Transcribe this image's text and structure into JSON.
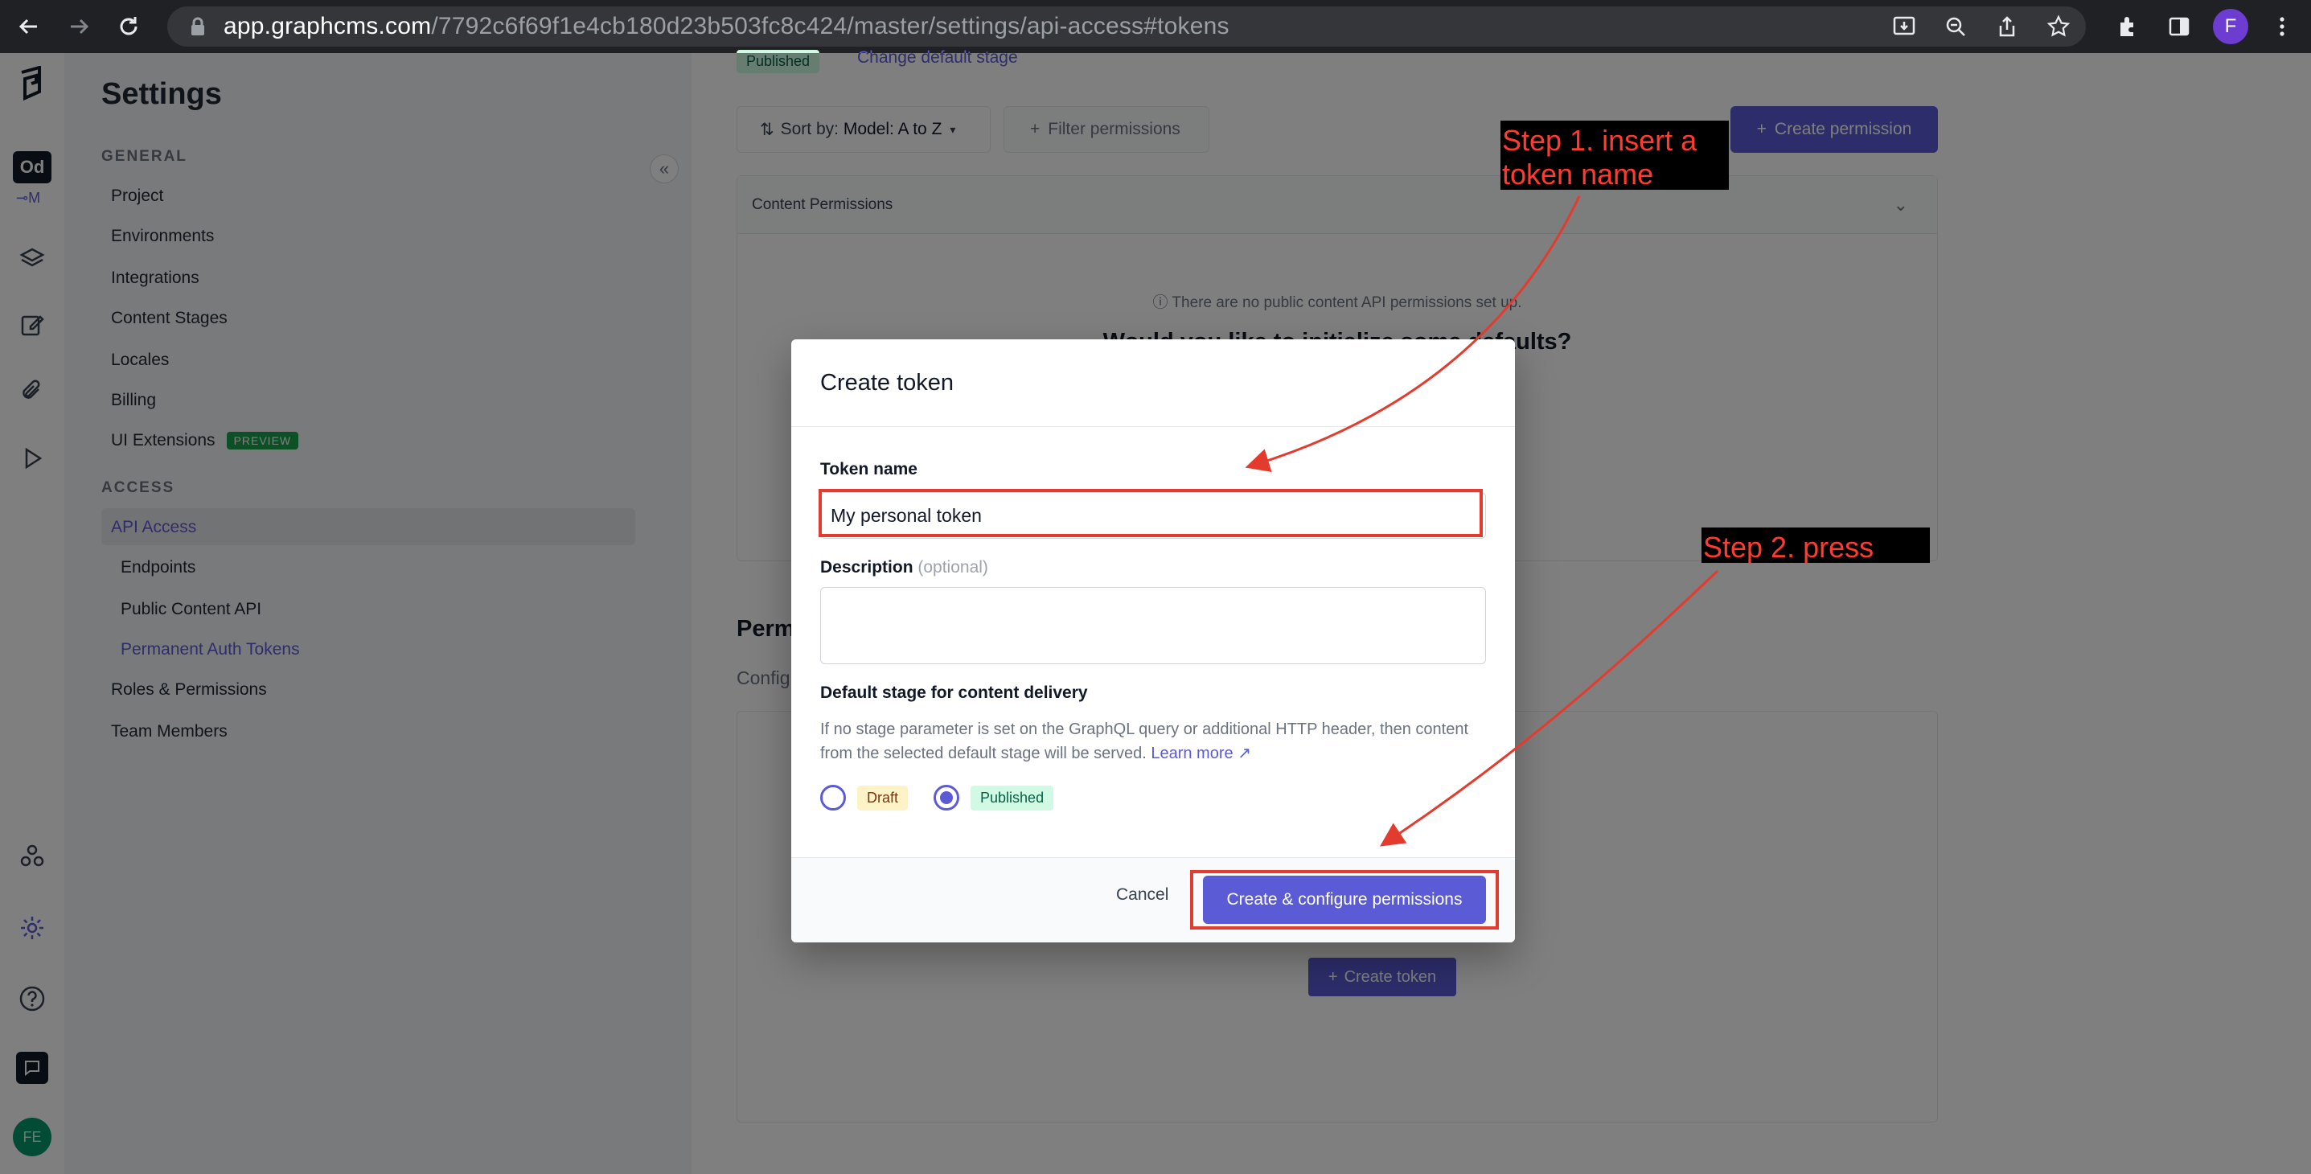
{
  "browser": {
    "url_host": "app.graphcms.com",
    "url_path": "/7792c6f69f1e4cb180d23b503fc8c424/master/settings/api-access#tokens",
    "profile_initial": "F"
  },
  "rail": {
    "project_badge": "Od",
    "project_sub": "⊸M",
    "user_initials": "FE"
  },
  "sidebar": {
    "title": "Settings",
    "general_label": "GENERAL",
    "general_items": [
      "Project",
      "Environments",
      "Integrations",
      "Content Stages",
      "Locales",
      "Billing",
      "UI Extensions"
    ],
    "preview_badge": "PREVIEW",
    "access_label": "ACCESS",
    "api_access": "API Access",
    "api_subitems": [
      "Endpoints",
      "Public Content API",
      "Permanent Auth Tokens"
    ],
    "roles": "Roles & Permissions",
    "team": "Team Members"
  },
  "main": {
    "published_badge": "Published",
    "change_stage": "Change default stage",
    "sort_label": "Sort by:",
    "sort_value": "Model: A to Z",
    "filter_label": "Filter permissions",
    "create_permission": "Create permission",
    "content_permissions": "Content Permissions",
    "no_permissions": "There are no public content API permissions set up.",
    "would_like": "Would you like to initialize some defaults?",
    "perm_heading": "Perm",
    "perm_sub": "Config",
    "create_token_btn": "Create token"
  },
  "modal": {
    "title": "Create token",
    "token_name_label": "Token name",
    "token_name_value": "My personal token",
    "description_label": "Description",
    "optional": "(optional)",
    "stage_label": "Default stage for content delivery",
    "help_text": "If no stage parameter is set on the GraphQL query or additional HTTP header, then content from the selected default stage will be served.",
    "learn_more": "Learn more",
    "stages": [
      "Draft",
      "Published"
    ],
    "selected_stage": "Published",
    "cancel": "Cancel",
    "confirm": "Create & configure permissions"
  },
  "annotations": {
    "step1": "Step 1. insert a token name",
    "step2": "Step 2. press",
    "color": "#e33b2e"
  }
}
